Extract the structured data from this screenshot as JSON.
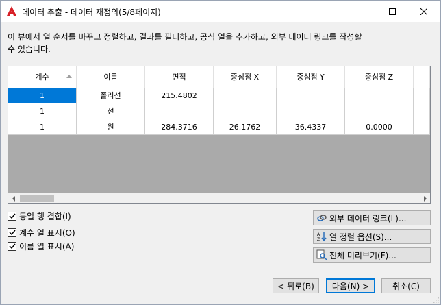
{
  "window": {
    "title": "데이터 추출 - 데이터 재정의(5/8페이지)"
  },
  "description": "이 뷰에서 열 순서를 바꾸고 정렬하고, 결과를 필터하고, 공식 열을 추가하고, 외부 데이터 링크를 작성할 수 있습니다.",
  "table": {
    "columns": [
      "계수",
      "이름",
      "면적",
      "중심점 X",
      "중심점 Y",
      "중심점 Z"
    ],
    "rows": [
      [
        "1",
        "폴리선",
        "215.4802",
        "",
        "",
        ""
      ],
      [
        "1",
        "선",
        "",
        "",
        "",
        ""
      ],
      [
        "1",
        "원",
        "284.3716",
        "26.1762",
        "36.4337",
        "0.0000"
      ]
    ]
  },
  "options": {
    "combine_rows": "동일 행 결합(I)",
    "show_count": "계수 열 표시(O)",
    "show_name": "이름 열 표시(A)"
  },
  "side_buttons": {
    "link_external": "외부 데이터 링크(L)...",
    "sort_options": "열 정렬 옵션(S)...",
    "full_preview": "전체 미리보기(F)..."
  },
  "nav": {
    "back": "< 뒤로(B)",
    "next": "다음(N) >",
    "cancel": "취소(C)"
  },
  "colors": {
    "selection": "#0078d7",
    "app_icon": "#d71f26"
  }
}
